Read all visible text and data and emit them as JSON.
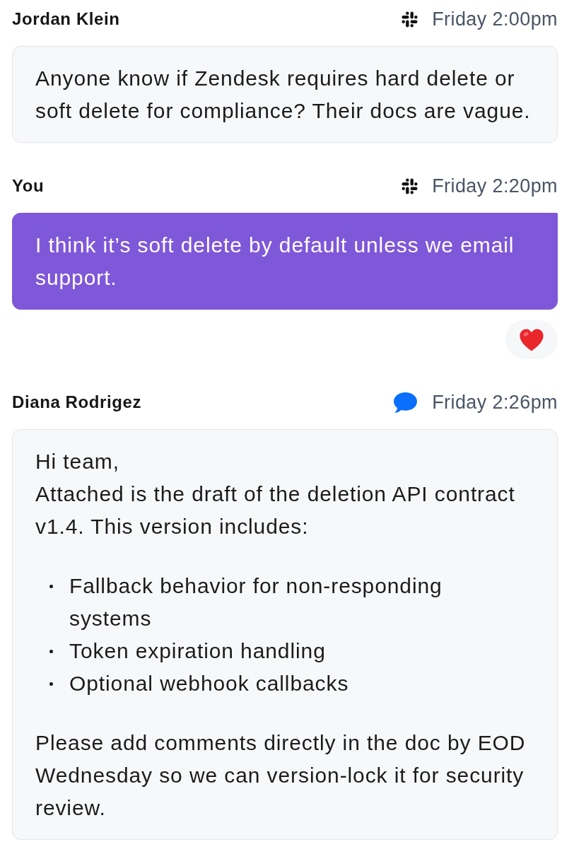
{
  "messages": [
    {
      "sender": "Jordan Klein",
      "source": {
        "kind": "hash"
      },
      "time": "Friday 2:00pm",
      "outgoing": false,
      "body": [
        {
          "kind": "paragraph",
          "text": "Anyone know if Zendesk requires hard delete or soft delete for compliance? Their docs are vague."
        }
      ]
    },
    {
      "sender": "You",
      "source": {
        "kind": "hash"
      },
      "time": "Friday 2:20pm",
      "outgoing": true,
      "body": [
        {
          "kind": "paragraph",
          "text": "I think it’s soft delete by default unless we email support."
        }
      ],
      "reactions": [
        {
          "kind": "heart"
        }
      ]
    },
    {
      "sender": "Diana Rodrigez",
      "source": {
        "kind": "bubble"
      },
      "time": "Friday 2:26pm",
      "outgoing": false,
      "body": [
        {
          "kind": "paragraph",
          "text": "Hi team,"
        },
        {
          "kind": "paragraph",
          "text": "Attached is the draft of the deletion API contract v1.4. This version includes:"
        },
        {
          "kind": "list",
          "items": [
            "Fallback behavior for non-responding systems",
            "Token expiration handling",
            "Optional webhook callbacks"
          ]
        },
        {
          "kind": "paragraph",
          "text": "Please add comments directly in the doc by EOD Wednesday so we can version-lock it for security review."
        }
      ]
    }
  ]
}
